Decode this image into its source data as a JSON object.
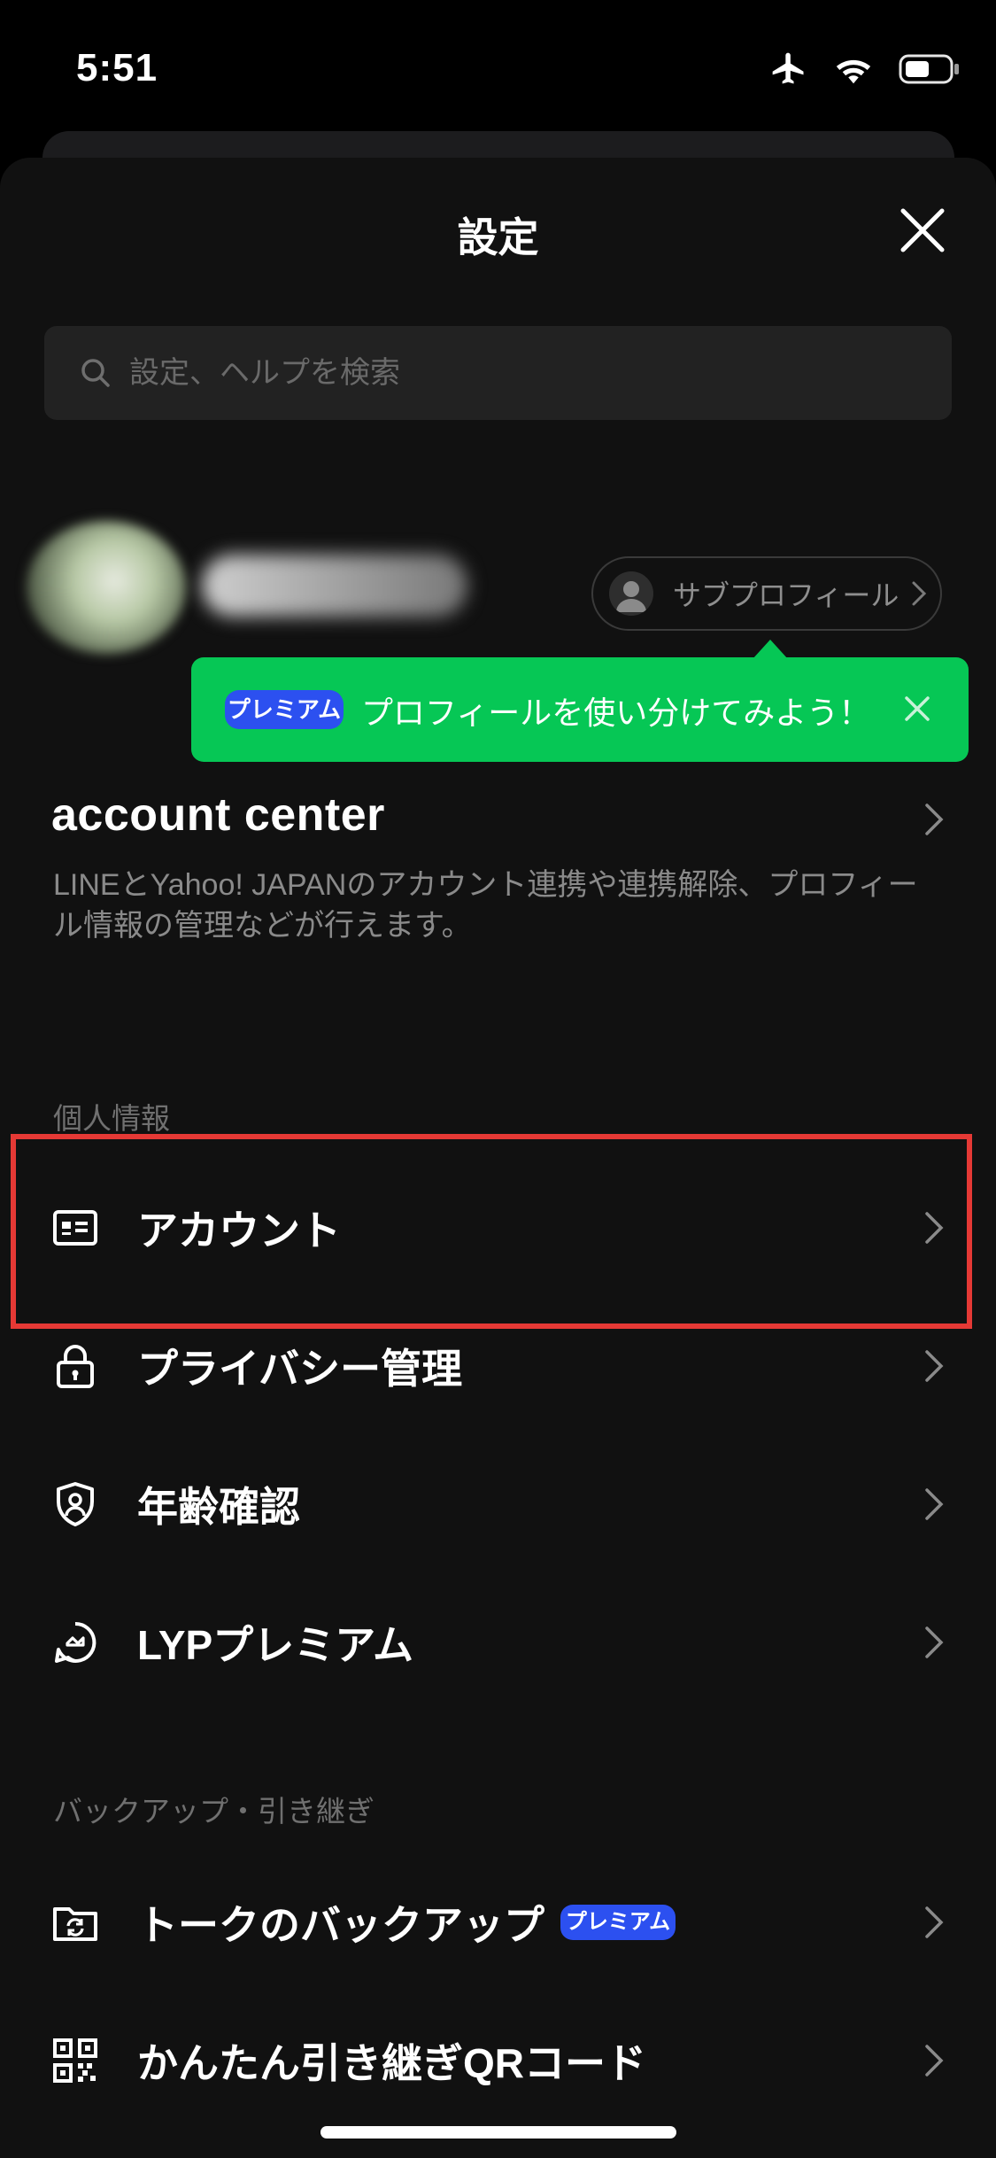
{
  "status_bar": {
    "time": "5:51"
  },
  "header": {
    "title": "設定"
  },
  "search": {
    "placeholder": "設定、ヘルプを検索"
  },
  "profile": {
    "subprofile_label": "サブプロフィール"
  },
  "tooltip": {
    "badge": "プレミアム",
    "text": "プロフィールを使い分けてみよう！"
  },
  "account_center": {
    "title": "account center",
    "description": "LINEとYahoo! JAPANのアカウント連携や連携解除、プロフィール情報の管理などが行えます。"
  },
  "sections": {
    "personal": {
      "label": "個人情報",
      "items": [
        {
          "label": "アカウント",
          "icon": "id-card-icon"
        },
        {
          "label": "プライバシー管理",
          "icon": "lock-icon"
        },
        {
          "label": "年齢確認",
          "icon": "shield-person-icon"
        },
        {
          "label": "LYPプレミアム",
          "icon": "premium-icon"
        }
      ]
    },
    "backup": {
      "label": "バックアップ・引き継ぎ",
      "items": [
        {
          "label": "トークのバックアップ",
          "badge": "プレミアム",
          "icon": "folder-sync-icon"
        },
        {
          "label": "かんたん引き継ぎQRコード",
          "icon": "qr-code-icon"
        }
      ]
    }
  },
  "colors": {
    "accent_green": "#06c755",
    "premium_blue": "#2c50f0",
    "highlight_red": "#e53935",
    "background": "#111111"
  }
}
